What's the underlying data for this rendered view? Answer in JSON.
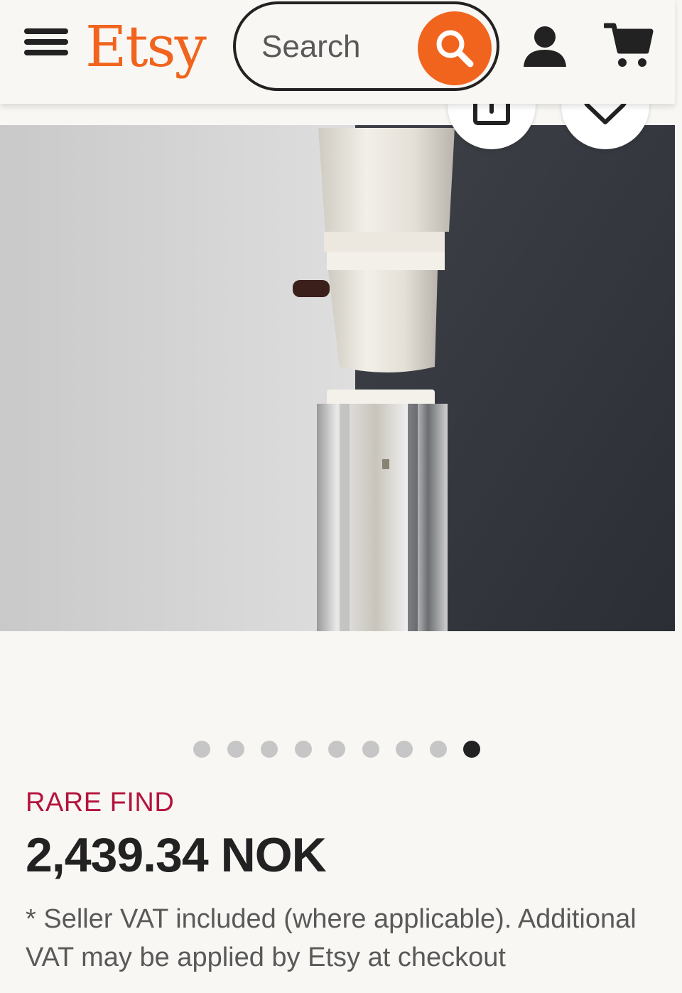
{
  "header": {
    "logo": "Etsy",
    "search_placeholder": "Search",
    "brand_color": "#f1641e"
  },
  "icons": {
    "menu": "menu-icon",
    "search": "search-icon",
    "user": "user-icon",
    "cart": "cart-icon",
    "share": "share-icon",
    "favorite": "heart-icon"
  },
  "gallery": {
    "total_images": 9,
    "active_index": 8
  },
  "listing": {
    "badge": "RARE FIND",
    "price": "2,439.34 NOK",
    "vat_note": "* Seller VAT included (where applicable). Additional VAT may be applied by Etsy at checkout"
  }
}
